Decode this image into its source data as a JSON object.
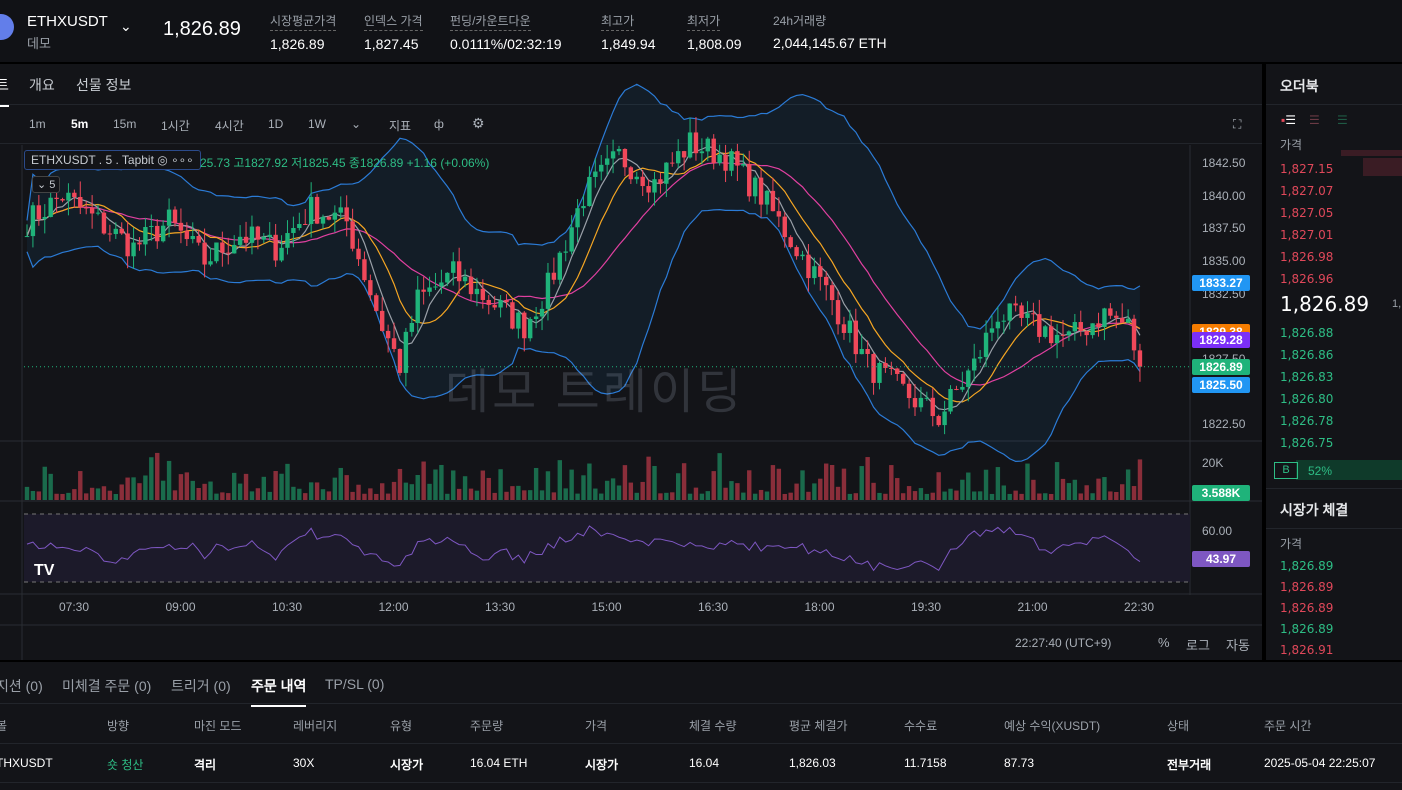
{
  "header": {
    "symbol": "ETHXUSDT",
    "mode": "데모",
    "last_price": "1,826.89",
    "stats": [
      {
        "label": "시장평균가격",
        "value": "1,826.89"
      },
      {
        "label": "인덱스 가격",
        "value": "1,827.45"
      },
      {
        "label": "펀딩/카운트다운",
        "value": "0.0111%/02:32:19"
      },
      {
        "label": "최고가",
        "value": "1,849.94"
      },
      {
        "label": "최저가",
        "value": "1,808.09"
      },
      {
        "label": "24h거래량",
        "value": "2,044,145.67 ETH"
      }
    ]
  },
  "chart_tabs": [
    "트",
    "개요",
    "선물 정보"
  ],
  "toolbar": {
    "intervals": [
      "1m",
      "5m",
      "15m",
      "1시간",
      "4시간",
      "1D",
      "1W"
    ],
    "active": "5m",
    "indicators": "지표"
  },
  "legend": {
    "title": "ETHXUSDT . 5 . Tapbit",
    "ohlc": "25.73 고1827.92 저1825.45 종1826.89 +1.16 (+0.06%)",
    "collapse": "5"
  },
  "watermark": "데모 트레이딩",
  "price_axis": [
    "1842.50",
    "1840.00",
    "1837.50",
    "1835.00",
    "1832.50",
    "1827.50",
    "1822.50"
  ],
  "price_labels": [
    {
      "v": "1833.27",
      "c": "#2196f3"
    },
    {
      "v": "1829.38",
      "c": "#f57c00"
    },
    {
      "v": "1829.28",
      "c": "#7b2ff7"
    },
    {
      "v": "1826.89",
      "c": "#1fb37a"
    },
    {
      "v": "1825.50",
      "c": "#2196f3"
    }
  ],
  "volume_axis": "20K",
  "volume_label": "3.588K",
  "rsi_axis": "60.00",
  "rsi_label": "43.97",
  "time_axis": [
    "07:30",
    "09:00",
    "10:30",
    "12:00",
    "13:30",
    "15:00",
    "16:30",
    "18:00",
    "19:30",
    "21:00",
    "22:30"
  ],
  "footer": {
    "clock": "22:27:40 (UTC+9)",
    "pct": "%",
    "log": "로그",
    "auto": "자동"
  },
  "chart_data": {
    "type": "candlestick",
    "interval": "5m",
    "ylim": [
      1821,
      1844.5
    ],
    "keypoints": [
      [
        0,
        1838
      ],
      [
        6,
        1840
      ],
      [
        12,
        1838
      ],
      [
        18,
        1836
      ],
      [
        24,
        1838
      ],
      [
        30,
        1835
      ],
      [
        36,
        1837
      ],
      [
        42,
        1836
      ],
      [
        48,
        1839
      ],
      [
        54,
        1838
      ],
      [
        60,
        1830
      ],
      [
        63,
        1827
      ],
      [
        66,
        1832
      ],
      [
        72,
        1834
      ],
      [
        78,
        1832
      ],
      [
        84,
        1830
      ],
      [
        88,
        1833
      ],
      [
        94,
        1840
      ],
      [
        100,
        1843
      ],
      [
        106,
        1841
      ],
      [
        112,
        1844
      ],
      [
        118,
        1843
      ],
      [
        124,
        1840
      ],
      [
        130,
        1836
      ],
      [
        136,
        1832
      ],
      [
        142,
        1827
      ],
      [
        148,
        1825
      ],
      [
        154,
        1823
      ],
      [
        160,
        1827
      ],
      [
        164,
        1831
      ],
      [
        170,
        1830
      ],
      [
        176,
        1829
      ],
      [
        182,
        1831
      ],
      [
        186,
        1830
      ],
      [
        188,
        1826.89
      ]
    ]
  },
  "orderbook": {
    "title": "오더북",
    "col_price": "가격",
    "asks": [
      "1,827.15",
      "1,827.07",
      "1,827.05",
      "1,827.01",
      "1,826.98",
      "1,826.96"
    ],
    "mid": "1,826.89",
    "mid_sub": "1,",
    "bids": [
      "1,826.88",
      "1,826.86",
      "1,826.83",
      "1,826.80",
      "1,826.78",
      "1,826.75"
    ],
    "ratio_b": "B",
    "ratio": "52%"
  },
  "trades": {
    "title": "시장가 체결",
    "col_price": "가격",
    "rows": [
      {
        "p": "1,826.89",
        "s": "buy"
      },
      {
        "p": "1,826.89",
        "s": "sell"
      },
      {
        "p": "1,826.89",
        "s": "sell"
      },
      {
        "p": "1,826.89",
        "s": "buy"
      },
      {
        "p": "1,826.91",
        "s": "sell"
      }
    ]
  },
  "bottom": {
    "tabs": [
      "지션 (0)",
      "미체결 주문 (0)",
      "트리거 (0)",
      "주문 내역",
      "TP/SL (0)"
    ],
    "active": 3,
    "headers": [
      "볼",
      "방향",
      "마진 모드",
      "레버리지",
      "유형",
      "주문량",
      "가격",
      "체결 수량",
      "평균 체결가",
      "수수료",
      "예상 수익(XUSDT)",
      "상태",
      "주문 시간"
    ],
    "row": [
      "THXUSDT",
      "숏 청산",
      "격리",
      "30X",
      "시장가",
      "16.04 ETH",
      "시장가",
      "16.04",
      "1,826.03",
      "11.7158",
      "87.73",
      "전부거래",
      "2025-05-04 22:25:07"
    ]
  }
}
